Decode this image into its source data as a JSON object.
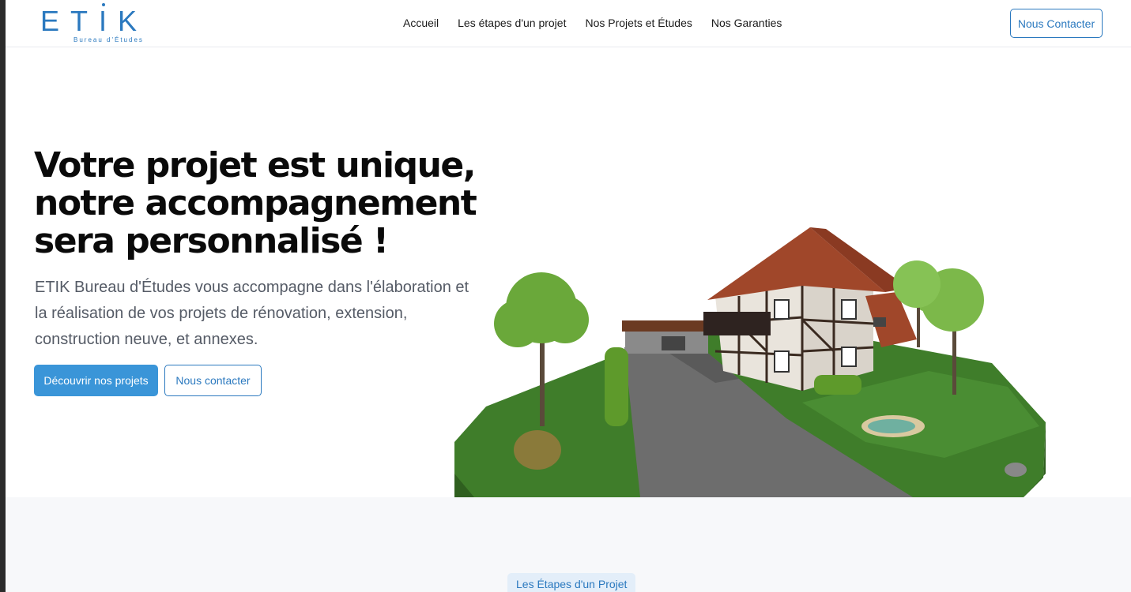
{
  "header": {
    "logo": {
      "title": "ETIK",
      "subtitle": "Bureau d'Études"
    },
    "nav": [
      {
        "label": "Accueil"
      },
      {
        "label": "Les étapes d'un projet"
      },
      {
        "label": "Nos Projets et Études"
      },
      {
        "label": "Nos Garanties"
      }
    ],
    "contact_button": "Nous Contacter"
  },
  "hero": {
    "title_line1": "Votre projet est unique,",
    "title_line2": "notre accompagnement",
    "title_line3": "sera personnalisé !",
    "description": "ETIK Bureau d'Études vous accompagne dans l'élaboration et la réalisation de vos projets de rénovation, extension, construction neuve, et annexes.",
    "primary_button": "Découvrir nos projets",
    "secondary_button": "Nous contacter",
    "image_icon": "3d-house-render"
  },
  "section": {
    "badge": "Les Étapes d'un Projet"
  },
  "colors": {
    "brand": "#2b79bf",
    "primary_button": "#3a95d8",
    "section_bg": "#f7f8fa"
  }
}
